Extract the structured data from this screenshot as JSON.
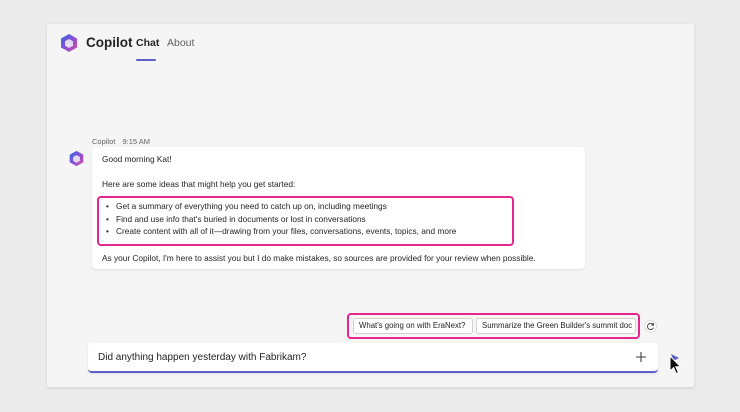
{
  "app": {
    "title": "Copilot"
  },
  "tabs": {
    "chat": "Chat",
    "about": "About"
  },
  "message": {
    "sender": "Copilot",
    "time": "9:15 AM",
    "greeting": "Good morning Kat!",
    "intro": "Here are some ideas that might help you get started:",
    "ideas": [
      "Get a summary of everything you need to catch up on, including meetings",
      "Find and use info that's buried in documents or lost in conversations",
      "Create content with all of it—drawing from your files, conversations, events, topics, and more"
    ],
    "outro": "As your Copilot, I'm here to assist you but I do make mistakes, so sources are provided for your review when possible."
  },
  "suggestions": [
    "What's going on with EraNext?",
    "Summarize the Green Builder's summit doc"
  ],
  "composer": {
    "value": "Did anything happen yesterday with Fabrikam?"
  },
  "colors": {
    "accent": "#5b5fc7",
    "highlight": "#e3288f"
  },
  "icons": {
    "logo": "copilot-logo-icon",
    "refresh": "refresh-icon",
    "add": "plus-icon",
    "send": "send-icon",
    "cursor": "mouse-pointer-icon"
  }
}
